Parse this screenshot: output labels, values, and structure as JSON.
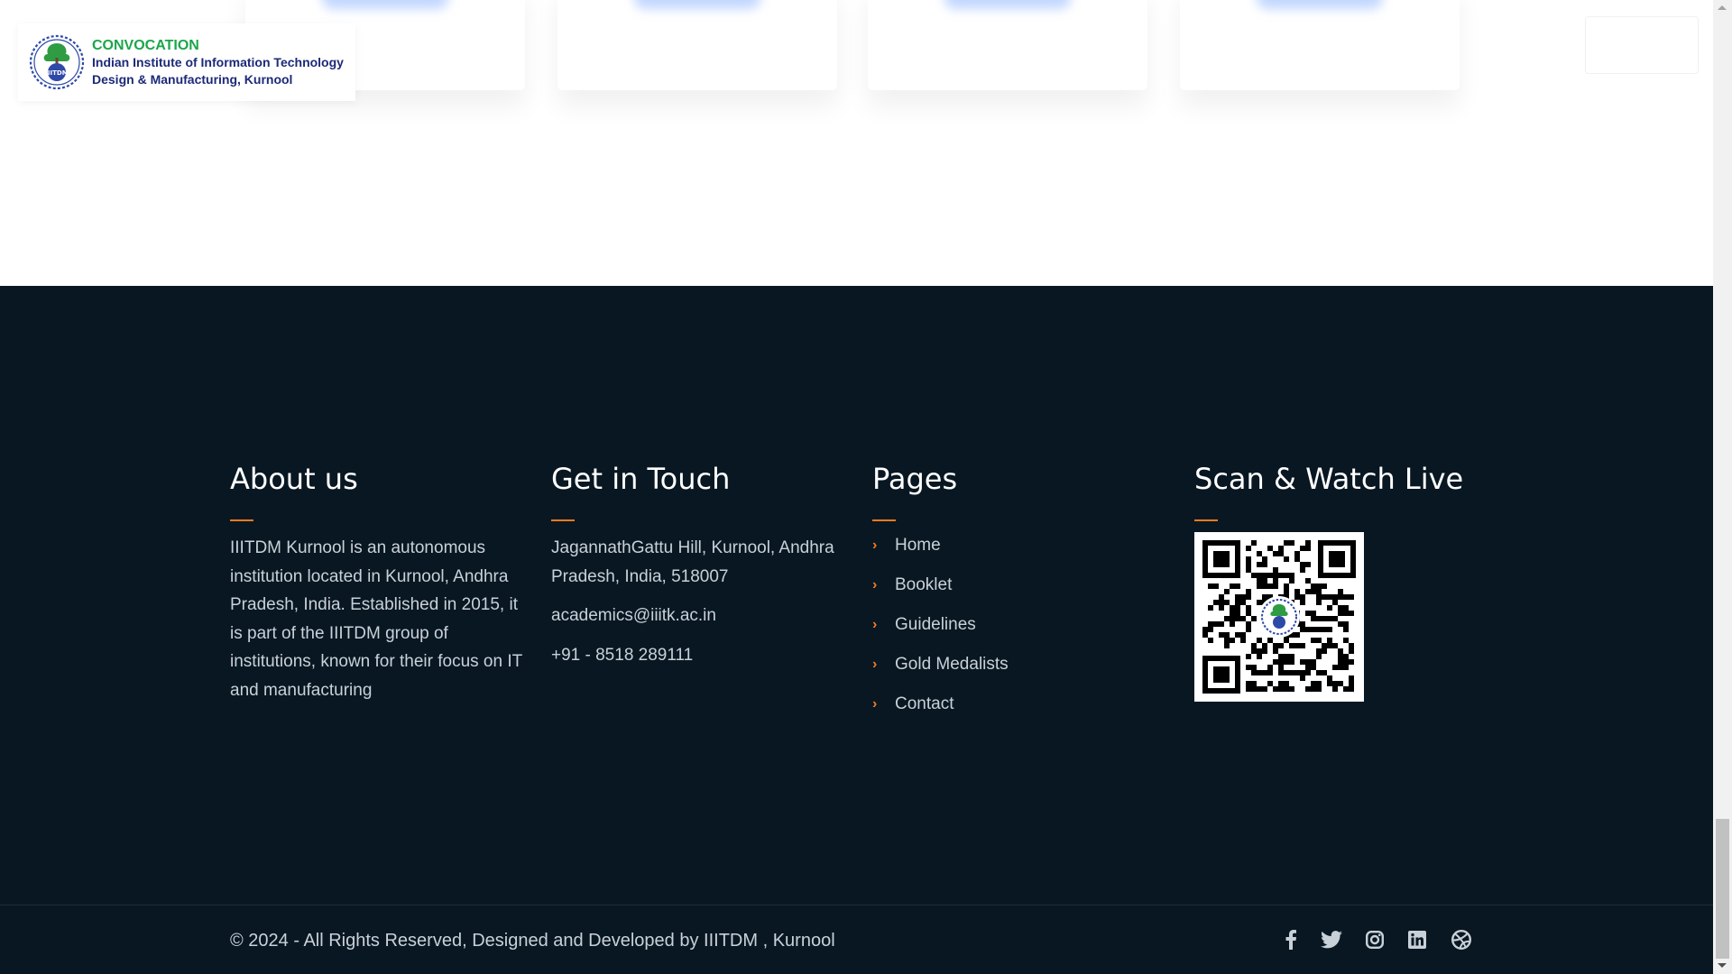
{
  "header": {
    "logo": {
      "line1": "CONVOCATION",
      "line2": "Indian Institute of Information Technology",
      "line3": "Design & Manufacturing, Kurnool",
      "seal_text": "IIITDM",
      "icon": "institute-seal-icon"
    }
  },
  "footer": {
    "about": {
      "title": "About us",
      "text": "IIITDM Kurnool is an autonomous institution located in Kurnool, Andhra Pradesh, India. Established in 2015, it is part of the IIITDM group of institutions, known for their focus on IT and manufacturing"
    },
    "contact": {
      "title": "Get in Touch",
      "address": "JagannathGattu Hill, Kurnool, Andhra Pradesh, India, 518007",
      "email": "academics@iiitk.ac.in",
      "phone": "+91 - 8518 289111"
    },
    "pages": {
      "title": "Pages",
      "items": [
        {
          "label": "Home"
        },
        {
          "label": "Booklet"
        },
        {
          "label": "Guidelines"
        },
        {
          "label": "Gold Medalists"
        },
        {
          "label": "Contact"
        }
      ]
    },
    "live": {
      "title": "Scan & Watch Live",
      "qr_icon": "qr-code-icon"
    },
    "copyright": "© 2024 - All Rights Reserved, Designed and Developed by IIITDM , Kurnool",
    "social": [
      {
        "icon": "facebook-icon"
      },
      {
        "icon": "twitter-icon"
      },
      {
        "icon": "instagram-icon"
      },
      {
        "icon": "linkedin-icon"
      },
      {
        "icon": "dribbble-icon"
      }
    ]
  },
  "colors": {
    "footer_bg": "#081722",
    "accent": "#f47a20",
    "text_muted": "#c9d1d8",
    "logo_green": "#1aa64a",
    "logo_navy": "#1c2a78"
  }
}
